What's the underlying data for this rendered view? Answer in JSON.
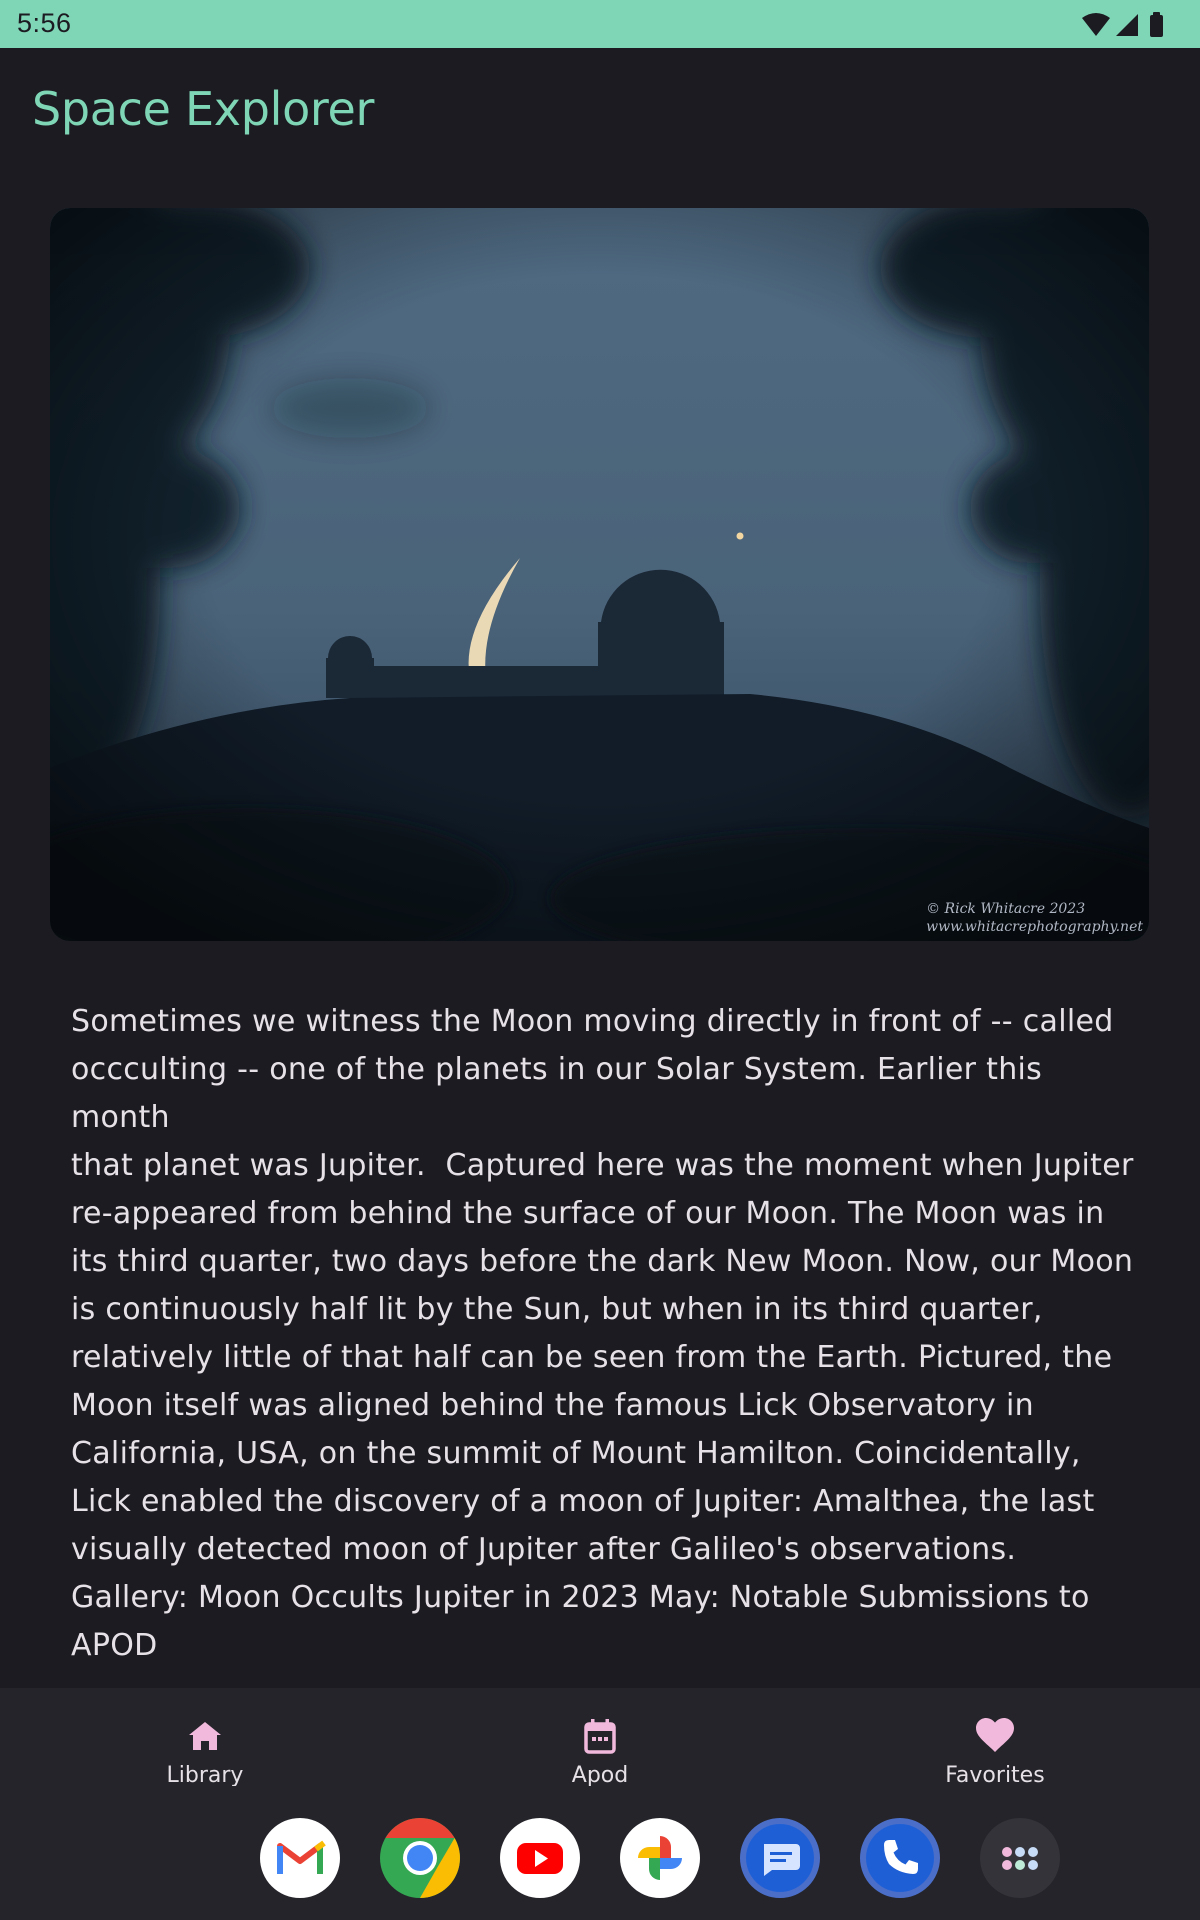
{
  "status_bar": {
    "time": "5:56",
    "icons": [
      "wifi-icon",
      "signal-icon",
      "battery-icon"
    ]
  },
  "app": {
    "title": "Space Explorer"
  },
  "apod": {
    "image_credit_line1": "© Rick Whitacre 2023",
    "image_credit_line2": "www.whitacrephotography.net",
    "description": "Sometimes we witness the Moon moving directly in front of -- called\noccculting -- one of the planets in our Solar System. Earlier this month\nthat planet was Jupiter.  Captured here was the moment when Jupiter\nre-appeared from behind the surface of our Moon. The Moon was in\nits third quarter, two days before the dark New Moon. Now, our Moon\nis continuously half lit by the Sun, but when in its third quarter,\nrelatively little of that half can be seen from the Earth. Pictured, the\nMoon itself was aligned behind the famous Lick Observatory in\nCalifornia, USA, on the summit of Mount Hamilton. Coincidentally,\nLick enabled the discovery of a moon of Jupiter: Amalthea, the last\nvisually detected moon of Jupiter after Galileo's observations.\nGallery: Moon Occults Jupiter in 2023 May: Notable Submissions to\nAPOD"
  },
  "bottom_nav": {
    "items": [
      {
        "label": "Library",
        "icon": "home-icon"
      },
      {
        "label": "Apod",
        "icon": "calendar-icon"
      },
      {
        "label": "Favorites",
        "icon": "heart-icon"
      }
    ]
  },
  "dock": {
    "apps": [
      "gmail-icon",
      "chrome-icon",
      "youtube-icon",
      "photos-icon",
      "messages-icon",
      "phone-icon",
      "app-drawer-icon"
    ]
  },
  "colors": {
    "accent": "#7fd6b6",
    "background": "#1c1b21",
    "nav_background": "#25242a",
    "nav_icon": "#f1b9dc",
    "text": "#e6e1e6"
  }
}
